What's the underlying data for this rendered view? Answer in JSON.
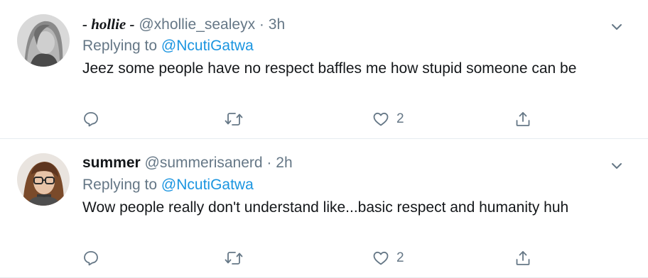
{
  "tweets": [
    {
      "display_name": "- hollie -",
      "handle": "@xhollie_sealeyx",
      "separator": "·",
      "time": "3h",
      "replying_prefix": "Replying to",
      "replying_to": "@NcutiGatwa",
      "text": "Jeez some people have no respect baffles me how stupid someone can be",
      "like_count": "2",
      "icons": [
        "chevron-down-icon",
        "reply-icon",
        "retweet-icon",
        "heart-icon",
        "share-icon"
      ]
    },
    {
      "display_name": "summer",
      "handle": "@summerisanerd",
      "separator": "·",
      "time": "2h",
      "replying_prefix": "Replying to",
      "replying_to": "@NcutiGatwa",
      "text": "Wow people really don't understand like...basic respect and humanity huh",
      "like_count": "2",
      "icons": [
        "chevron-down-icon",
        "reply-icon",
        "retweet-icon",
        "heart-icon",
        "share-icon"
      ]
    }
  ],
  "colors": {
    "text": "#14171a",
    "muted": "#657786",
    "link": "#1b95e0",
    "divider": "#e6ecf0"
  }
}
